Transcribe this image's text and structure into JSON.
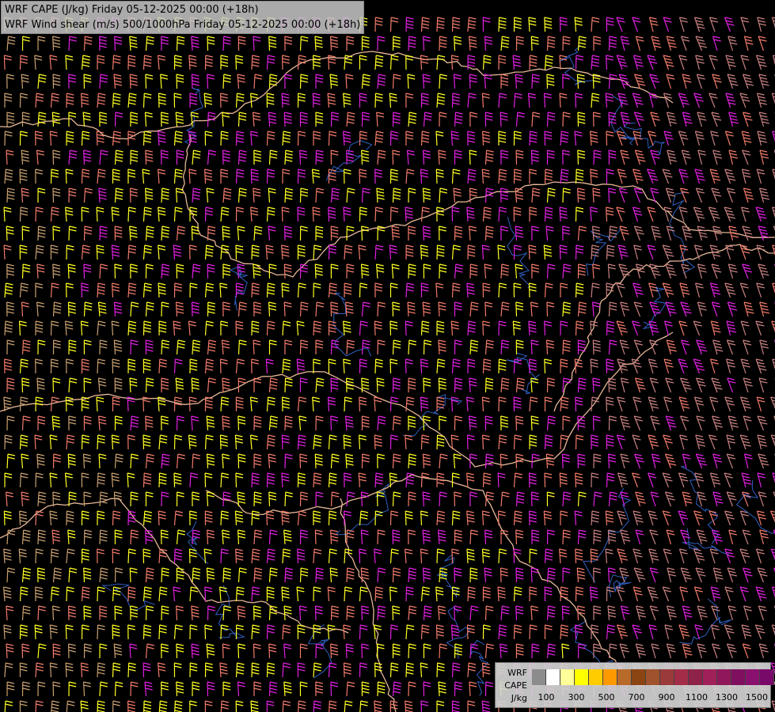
{
  "title": {
    "line1": "WRF CAPE (J/kg) Friday 05-12-2025 00:00 (+18h)",
    "line2": "WRF Wind shear (m/s) 500/1000hPa Friday 05-12-2025 00:00 (+18h)"
  },
  "legend": {
    "label_model": "WRF",
    "label_field": "CAPE",
    "label_unit": "J/kg",
    "colors": [
      "#8c8c8c",
      "#ffffff",
      "#ffff99",
      "#ffff00",
      "#ffcc00",
      "#ff9900",
      "#b86a2a",
      "#8b4513",
      "#a0522d",
      "#9b3a3a",
      "#a32d48",
      "#8e2248",
      "#a0205a",
      "#90185a",
      "#7f1060",
      "#8a1070",
      "#7a0a6a"
    ],
    "ticks": [
      "100",
      "300",
      "500",
      "700",
      "900",
      "1100",
      "1300",
      "1500"
    ]
  },
  "barb_colors": {
    "yellow": "#ffff22",
    "salmon": "#f07a6a",
    "magenta": "#e020e0",
    "tan": "#c9a070",
    "rose": "#c88080"
  },
  "border_color": "#e8b898",
  "river_color": "#3060c0"
}
